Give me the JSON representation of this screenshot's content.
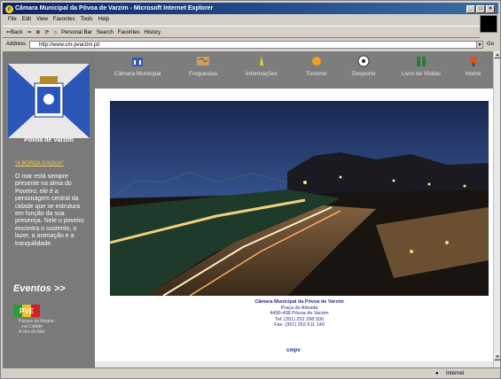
{
  "browser": {
    "title": "Câmara Municipal da Póvoa de Varzim - Microsoft Internet Explorer",
    "menu": [
      "File",
      "Edit",
      "View",
      "Favorites",
      "Tools",
      "Help"
    ],
    "toolbar": [
      "⇐Back",
      "⇒",
      "⊗",
      "⟳",
      "⌂",
      "Personal Bar",
      "Search",
      "Favorites",
      "History"
    ],
    "address_label": "Address",
    "url": "http://www.cm-pvarzim.pt/",
    "go_label": "Go",
    "status_left": "",
    "status_zone": "Internet"
  },
  "site": {
    "nav": [
      {
        "label": "Câmara Municipal",
        "icon": "building-icon"
      },
      {
        "label": "Freguesias",
        "icon": "map-icon"
      },
      {
        "label": "Informações",
        "icon": "info-icon"
      },
      {
        "label": "Turismo",
        "icon": "sun-icon"
      },
      {
        "label": "Desporto",
        "icon": "soccer-ball-icon"
      },
      {
        "label": "Livro de Visitas",
        "icon": "book-icon"
      },
      {
        "label": "Home",
        "icon": "home-icon"
      }
    ],
    "town_name": "Póvoa de Varzim",
    "story_link": "\"A BORDA D'AGUA\"",
    "story_text": "O mar está sempre presente na alma do Poveiro; ele é a personagem central da cidade que se estrutura em função da sua presença. Nele o poveiro encontra o sustento, o lazer, a animação e a tranquilidade.",
    "events_heading": "Eventos >>",
    "events_logo": "PVE",
    "events_text": "Parque da Alegria\n...na Cidade\nA Vez do Mar",
    "caption": {
      "title": "Câmara Municipal da Póvoa de Varzim",
      "line1": "Praça do Almada",
      "line2": "4490-438 Póvoa de Varzim",
      "line3": "Tel: (351) 252 298 500",
      "line4": "Fax: (351) 252 611 140"
    },
    "badge": "cmpv"
  },
  "colors": {
    "panel": "#7a7a7a",
    "accent": "#ffd24a",
    "title_blue": "#0a246a"
  }
}
